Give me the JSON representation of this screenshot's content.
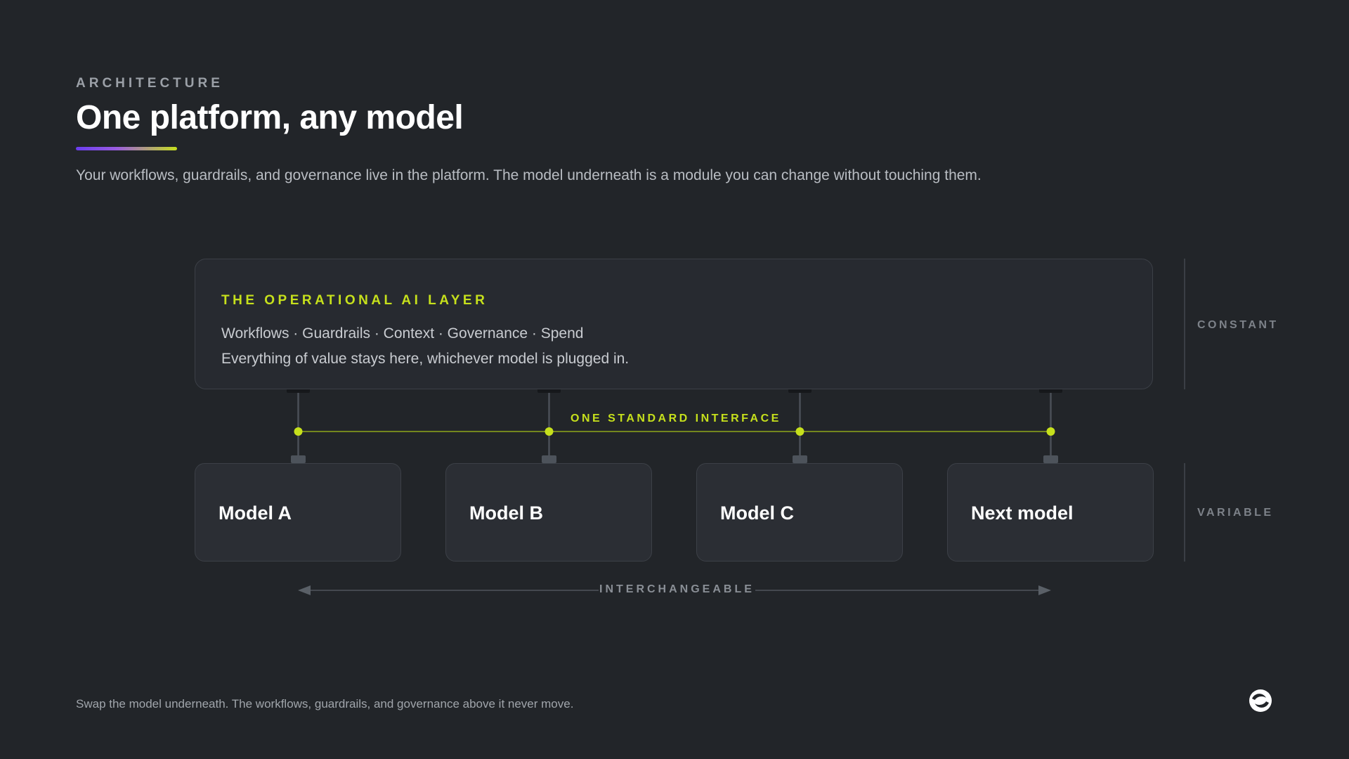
{
  "header": {
    "eyebrow": "ARCHITECTURE",
    "title": "One platform, any model",
    "subtitle": "Your workflows, guardrails, and governance live in the platform. The model underneath is a module you can change without touching them."
  },
  "layer": {
    "label": "THE OPERATIONAL AI LAYER",
    "line1": "Workflows · Guardrails · Context · Governance · Spend",
    "line2": "Everything of value stays here, whichever model is plugged in."
  },
  "side_labels": {
    "constant": "CONSTANT",
    "variable": "VARIABLE"
  },
  "interface_label": "ONE STANDARD INTERFACE",
  "models": [
    {
      "label": "Model A"
    },
    {
      "label": "Model B"
    },
    {
      "label": "Model C"
    },
    {
      "label": "Next model"
    }
  ],
  "interchangeable_label": "INTERCHANGEABLE",
  "footer": "Swap the model underneath. The workflows, guardrails, and governance above it never move.",
  "colors": {
    "background": "#222529",
    "accent": "#c6e01c",
    "card": "#2b2e34",
    "border": "#3c4047"
  },
  "icons": {
    "logo": "brand-logo-icon"
  }
}
